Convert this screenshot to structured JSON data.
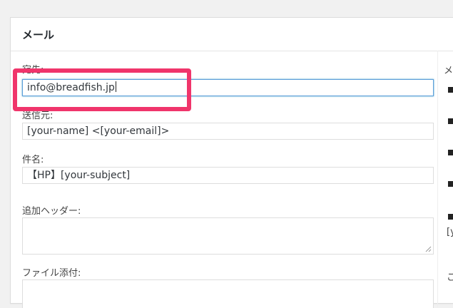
{
  "panel": {
    "title": "メール"
  },
  "fields": {
    "to": {
      "label": "宛先:",
      "value": "info@breadfish.jp"
    },
    "from": {
      "label": "送信元:",
      "value": "[your-name] <[your-email]>"
    },
    "subject": {
      "label": "件名:",
      "value": "【HP】[your-subject]"
    },
    "additional_headers": {
      "label": "追加ヘッダー:",
      "value": ""
    },
    "file_attachments": {
      "label": "ファイル添付:",
      "value": ""
    }
  },
  "sidebar": {
    "heading_partial": "メ",
    "item_partial": "[y",
    "item_partial2": "こ"
  },
  "colors": {
    "highlight": "#f0356b",
    "focus_border": "#5b9dd9"
  }
}
